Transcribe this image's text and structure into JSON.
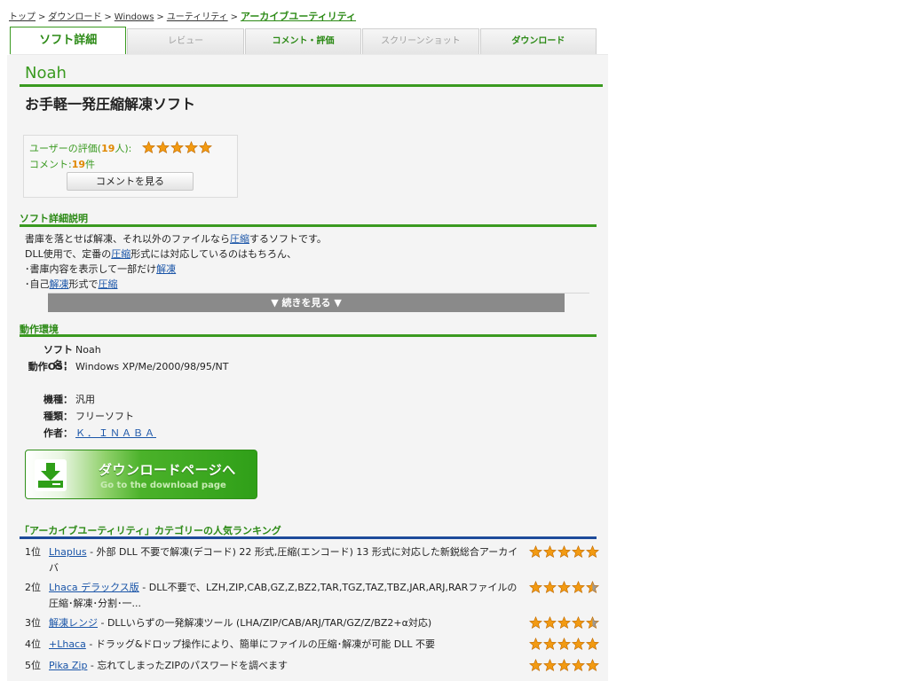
{
  "breadcrumb": {
    "items": [
      "トップ",
      "ダウンロード",
      "Windows",
      "ユーティリティ"
    ],
    "current": "アーカイブユーティリティ",
    "separator": ">"
  },
  "tabs": [
    {
      "label": "ソフト詳細",
      "state": "active"
    },
    {
      "label": "レビュー",
      "state": "disabled"
    },
    {
      "label": "コメント・評価",
      "state": "enabled"
    },
    {
      "label": "スクリーンショット",
      "state": "disabled"
    },
    {
      "label": "ダウンロード",
      "state": "enabled"
    }
  ],
  "software": {
    "name": "Noah",
    "catchcopy": "お手軽一発圧縮解凍ソフト"
  },
  "rating": {
    "label_prefix": "ユーザーの評価(",
    "count": "19",
    "label_suffix": "人):",
    "stars": 5,
    "comment_label": "コメント:",
    "comment_count": "19",
    "comment_unit": "件",
    "comment_button": "コメントを見る"
  },
  "description": {
    "heading": "ソフト詳細説明",
    "lines": [
      [
        {
          "t": "書庫を落とせば解凍、それ以外のファイルなら"
        },
        {
          "t": "圧縮",
          "link": true
        },
        {
          "t": "するソフトです。"
        }
      ],
      [
        {
          "t": "DLL使用で、定番の"
        },
        {
          "t": "圧縮",
          "link": true
        },
        {
          "t": "形式には対応しているのはもちろん、"
        }
      ],
      [
        {
          "t": "･書庫内容を表示して一部だけ"
        },
        {
          "t": "解凍",
          "link": true
        }
      ],
      [
        {
          "t": "･自己"
        },
        {
          "t": "解凍",
          "link": true
        },
        {
          "t": "形式で"
        },
        {
          "t": "圧縮",
          "link": true
        }
      ]
    ],
    "more_button": "▼ 続きを見る ▼"
  },
  "environment": {
    "heading": "動作環境",
    "software_name_label": "ソフト名：",
    "software_name": "Noah",
    "os_label": "動作OS：",
    "os": "Windows XP/Me/2000/98/95/NT",
    "model_label": "機種：",
    "model": "汎用",
    "type_label": "種類：",
    "type": "フリーソフト",
    "author_label": "作者：",
    "author": "Ｋ．ＩＮＡＢＡ"
  },
  "download_banner": {
    "title": "ダウンロードページへ",
    "subtitle": "Go to the download page",
    "icon": "download-icon"
  },
  "ranking": {
    "heading": "「アーカイブユーティリティ」カテゴリーの人気ランキング",
    "items": [
      {
        "rank": "1位",
        "name": "Lhaplus",
        "desc": " - 外部 DLL 不要で解凍(デコード) 22 形式,圧縮(エンコード) 13 形式に対応した新鋭総合アーカイバ",
        "stars": 5
      },
      {
        "rank": "2位",
        "name": "Lhaca デラックス版",
        "desc": " - DLL不要で、LZH,ZIP,CAB,GZ,Z,BZ2,TAR,TGZ,TAZ,TBZ,JAR,ARJ,RARファイルの圧縮･解凍･分割･一...",
        "stars": 4.5
      },
      {
        "rank": "3位",
        "name": "解凍レンジ",
        "desc": " - DLLいらずの一発解凍ツール (LHA/ZIP/CAB/ARJ/TAR/GZ/Z/BZ2+α対応)",
        "stars": 4.5
      },
      {
        "rank": "4位",
        "name": "+Lhaca",
        "desc": " - ドラッグ&ドロップ操作により、簡単にファイルの圧縮･解凍が可能 DLL 不要",
        "stars": 5
      },
      {
        "rank": "5位",
        "name": "Pika Zip",
        "desc": " - 忘れてしまったZIPのパスワードを調べます",
        "stars": 5
      }
    ]
  },
  "colors": {
    "accent_green": "#3a9a20",
    "heading_blue": "#1d4b9a",
    "star_orange": "#f29a12",
    "link_blue": "#1a55a8"
  }
}
